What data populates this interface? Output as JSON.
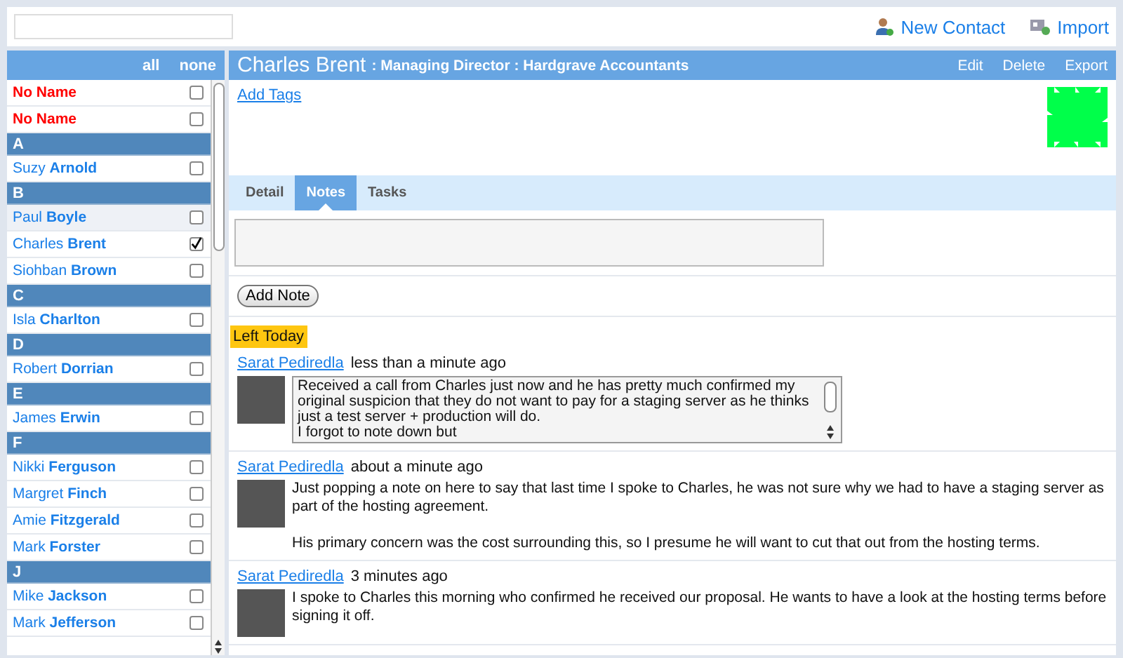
{
  "top_actions": [
    {
      "label": "New Contact"
    },
    {
      "label": "Import"
    }
  ],
  "list_header": {
    "links": [
      "all",
      "none"
    ]
  },
  "contacts": [
    {
      "kind": "nameless",
      "name": "No Name",
      "checked": false,
      "hovered": false
    },
    {
      "kind": "nameless",
      "name": "No Name",
      "checked": false,
      "hovered": false
    },
    {
      "kind": "group",
      "name": "A"
    },
    {
      "kind": "contact",
      "name": "Suzy **Arnold**",
      "checked": false,
      "hovered": false
    },
    {
      "kind": "group",
      "name": "B"
    },
    {
      "kind": "contact",
      "name": "Paul **Boyle**",
      "checked": false,
      "hovered": true
    },
    {
      "kind": "contact",
      "name": "Charles **Brent**",
      "checked": true,
      "hovered": false
    },
    {
      "kind": "contact",
      "name": "Siohban **Brown**",
      "checked": false,
      "hovered": false
    },
    {
      "kind": "group",
      "name": "C"
    },
    {
      "kind": "contact",
      "name": "Isla **Charlton**",
      "checked": false,
      "hovered": false
    },
    {
      "kind": "group",
      "name": "D"
    },
    {
      "kind": "contact",
      "name": "Robert **Dorrian**",
      "checked": false,
      "hovered": false
    },
    {
      "kind": "group",
      "name": "E"
    },
    {
      "kind": "contact",
      "name": "James **Erwin**",
      "checked": false,
      "hovered": false
    },
    {
      "kind": "group",
      "name": "F"
    },
    {
      "kind": "contact",
      "name": "Nikki **Ferguson**",
      "checked": false,
      "hovered": false
    },
    {
      "kind": "contact",
      "name": "Margret **Finch**",
      "checked": false,
      "hovered": false
    },
    {
      "kind": "contact",
      "name": "Amie **Fitzgerald**",
      "checked": false,
      "hovered": false
    },
    {
      "kind": "contact",
      "name": "Mark **Forster**",
      "checked": false,
      "hovered": false
    },
    {
      "kind": "group",
      "name": "J"
    },
    {
      "kind": "contact",
      "name": "Mike **Jackson**",
      "checked": false,
      "hovered": false
    },
    {
      "kind": "contact",
      "name": "Mark **Jefferson**",
      "checked": false,
      "hovered": false
    }
  ],
  "contact": {
    "name": "Charles Brent",
    "subtitle": ": Managing Director : Hardgrave Accountants",
    "actions": [
      "Edit",
      "Delete",
      "Export"
    ],
    "add_tags": "Add Tags"
  },
  "tabs": [
    {
      "label": "Detail",
      "selected": false
    },
    {
      "label": "Notes",
      "selected": true
    },
    {
      "label": "Tasks",
      "selected": false
    }
  ],
  "note_input": {
    "button": "Add Note"
  },
  "section_label": "Left Today",
  "notes": [
    {
      "kind": "scrolling",
      "author": "Sarat Pediredla",
      "time": "less than a minute ago",
      "paragraphs": [
        "Received a call from Charles just now and he has pretty much confirmed my original suspicion that they do not want to pay for a staging server as he thinks just a test server + production will do.",
        "I forgot to note down but"
      ]
    },
    {
      "kind": "plain",
      "author": "Sarat Pediredla",
      "time": "about a minute ago",
      "paragraphs": [
        "Just popping a note on here to say that last time I spoke to Charles, he was not sure why we had to have a staging server as part of the hosting agreement.",
        "His primary concern was the cost surrounding this, so I presume he will want to cut that out from the hosting terms."
      ]
    },
    {
      "kind": "plain",
      "author": "Sarat Pediredla",
      "time": "3 minutes ago",
      "paragraphs": [
        "I spoke to Charles this morning who confirmed he received our proposal. He wants to have a look at the hosting terms before signing it off."
      ]
    }
  ]
}
